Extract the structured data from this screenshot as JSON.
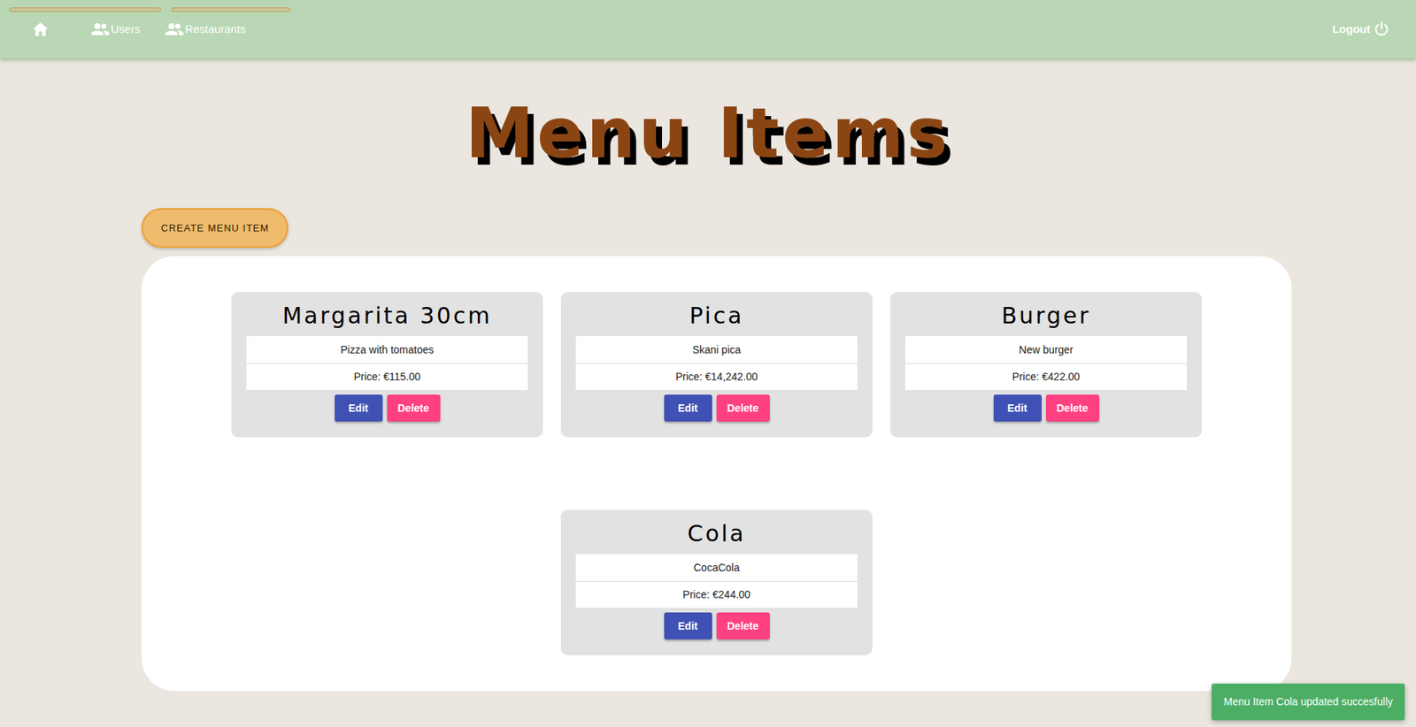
{
  "nav": {
    "items": [
      {
        "label": "Users"
      },
      {
        "label": "Restaurants"
      }
    ],
    "logout": "Logout"
  },
  "page": {
    "title": "Menu Items"
  },
  "create_button": "CREATE MENU ITEM",
  "menu_items": [
    {
      "name": "Margarita 30cm",
      "description": "Pizza with tomatoes",
      "price": "Price: €115.00"
    },
    {
      "name": "Pica",
      "description": "Skani pica",
      "price": "Price: €14,242.00"
    },
    {
      "name": "Burger",
      "description": "New burger",
      "price": "Price: €422.00"
    },
    {
      "name": "Cola",
      "description": "CocaCola",
      "price": "Price: €244.00"
    }
  ],
  "actions": {
    "edit": "Edit",
    "delete": "Delete"
  },
  "toast": {
    "message": "Menu Item Cola updated succesfully"
  }
}
